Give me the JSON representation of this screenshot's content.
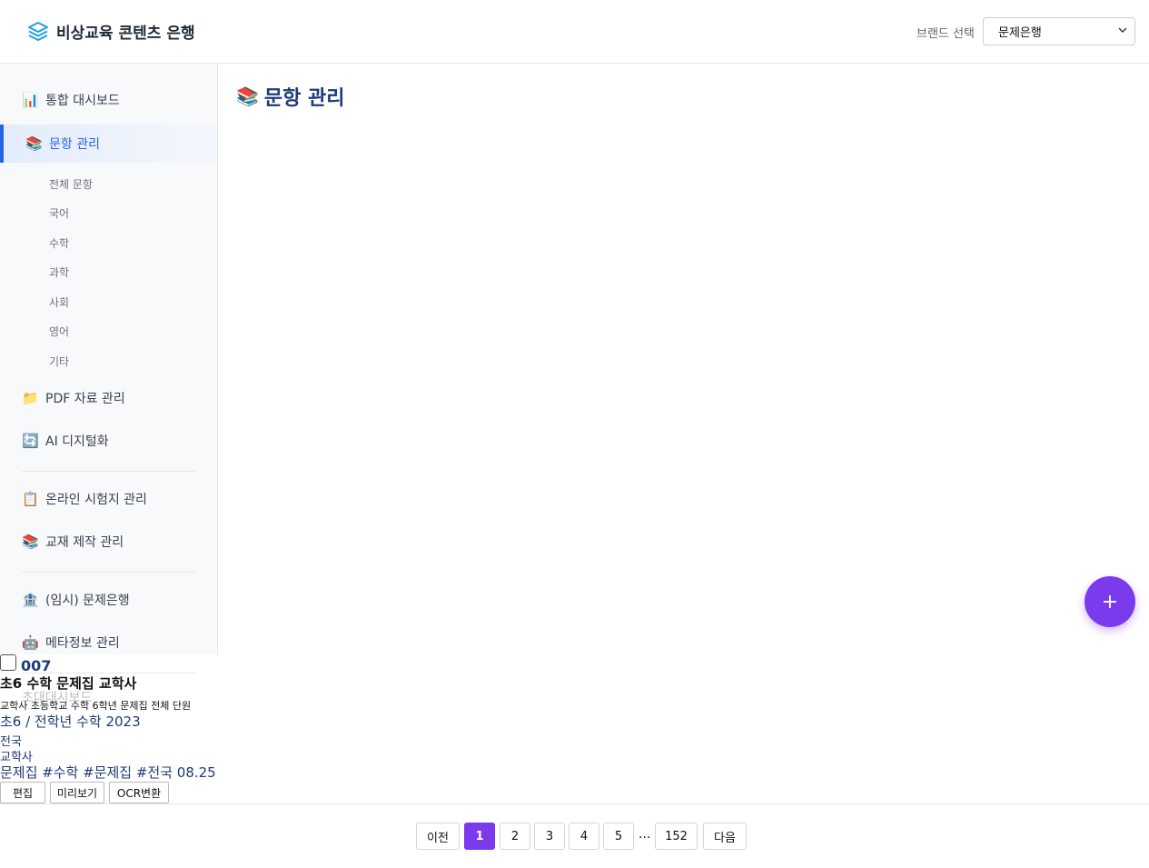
{
  "header": {
    "app_title": "비상교육 콘텐츠 은행",
    "brand_label": "브랜드 선택",
    "brand_selected": "문제은행"
  },
  "sidebar": {
    "items": [
      {
        "icon": "bar-chart-icon",
        "glyph": "📊",
        "label": "통합 대시보드"
      },
      {
        "icon": "books-icon",
        "glyph": "📚",
        "label": "문항 관리",
        "active": true
      },
      {
        "icon": "folder-icon",
        "glyph": "📁",
        "label": "PDF 자료 관리"
      },
      {
        "icon": "refresh-icon",
        "glyph": "🔄",
        "label": "AI 디지털화"
      },
      {
        "icon": "clipboard-icon",
        "glyph": "📋",
        "label": "온라인 시험지 관리"
      },
      {
        "icon": "books-icon",
        "glyph": "📚",
        "label": "교재 제작 관리"
      },
      {
        "icon": "bank-icon",
        "glyph": "🏦",
        "label": "(임시) 문제은행"
      },
      {
        "icon": "robot-icon",
        "glyph": "🤖",
        "label": "메타정보 관리"
      }
    ],
    "subitems": [
      "전체 문항",
      "국어",
      "수학",
      "과학",
      "사회",
      "영어",
      "기타"
    ],
    "ghost_label": "초대대시보드"
  },
  "main": {
    "title": "문항 관리",
    "title_glyph": "📚",
    "fab_label": "+"
  },
  "card": {
    "number": "007",
    "title": "초6 수학 문제집 교학사",
    "description": "교학사 초등학교 수학 6학년 문제집 전체 단원",
    "meta": "초6 / 전학년 수학 2023",
    "region": "전국",
    "publisher": "교학사",
    "tags": "문제집 #수학 #문제집 #전국 08.25",
    "buttons": {
      "edit": "편집",
      "preview": "미리보기",
      "ocr": "OCR변환"
    }
  },
  "pagination": {
    "prev": "이전",
    "pages": [
      "1",
      "2",
      "3",
      "4",
      "5"
    ],
    "ellipsis": "...",
    "last": "152",
    "next": "다음",
    "current": "1"
  },
  "colors": {
    "accent": "#7c3aed",
    "primary": "#2563eb",
    "title_navy": "#1e3a7a"
  }
}
